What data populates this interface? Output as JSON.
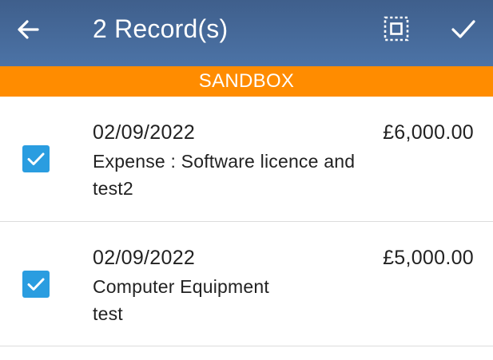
{
  "header": {
    "title": "2 Record(s)",
    "back_icon": "arrow-left-icon",
    "select_all_icon": "select-all-icon",
    "confirm_icon": "checkmark-icon",
    "background_color": "#4a6e9f"
  },
  "banner": {
    "label": "SANDBOX",
    "color": "#ff8c00"
  },
  "records": [
    {
      "checked": true,
      "date": "02/09/2022",
      "amount": "£6,000.00",
      "description_line1": "Expense : Software licence and",
      "description_line2": "test2"
    },
    {
      "checked": true,
      "date": "02/09/2022",
      "amount": "£5,000.00",
      "description_line1": "Computer Equipment",
      "description_line2": "test"
    }
  ],
  "checkbox_color": "#2a9de0"
}
